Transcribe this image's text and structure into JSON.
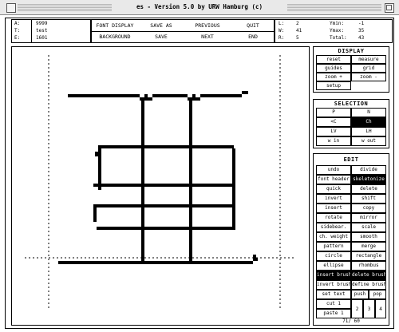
{
  "window": {
    "title": "es  -  Version 5.0  by URW Hamburg (c)"
  },
  "info": {
    "left": [
      {
        "key": "A:",
        "value": "9999"
      },
      {
        "key": "T:",
        "value": "test"
      },
      {
        "key": "E:",
        "value": "1601"
      }
    ],
    "mid": [
      {
        "key": "L:",
        "value": "2"
      },
      {
        "key": "W:",
        "value": "41"
      },
      {
        "key": "R:",
        "value": "5"
      }
    ],
    "right": [
      {
        "key": "Ymin:",
        "value": "-1"
      },
      {
        "key": "Ymax:",
        "value": "35"
      },
      {
        "key": "Total:",
        "value": "43"
      }
    ]
  },
  "toolbar": {
    "row1": [
      "FONT DISPLAY",
      "SAVE AS",
      "PREVIOUS",
      "QUIT"
    ],
    "row2": [
      "BACKGROUND",
      "SAVE",
      "NEXT",
      "END"
    ]
  },
  "display": {
    "title": "DISPLAY",
    "items": [
      "reset",
      "measure",
      "guides",
      "grid",
      "zoom +",
      "zoom -",
      "setup"
    ]
  },
  "selection": {
    "title": "SELECTION",
    "items": [
      "P",
      "N",
      "<C",
      "Ch",
      "LV",
      "LH",
      "w in",
      "w out"
    ],
    "active": "Ch"
  },
  "edit": {
    "title": "EDIT",
    "items": [
      "undo",
      "divide",
      "font header",
      "skeletonize",
      "quick",
      "delete",
      "invert",
      "shift",
      "insert",
      "copy",
      "rotate",
      "mirror",
      "sidebear.",
      "scale",
      "ch. weight",
      "smooth",
      "pattern",
      "merge",
      "circle",
      "rectangle",
      "ellipse",
      "rhombus",
      "insert brush",
      "delete brush",
      "invert brush",
      "define brush"
    ],
    "active": [
      "skeletonize",
      "insert brush",
      "delete brush"
    ],
    "set_text": "set text",
    "push": "push",
    "pop": "pop",
    "cut": "cut 1",
    "paste": "paste 1",
    "numbers": [
      "2",
      "3",
      "4"
    ],
    "footer": "71/    60"
  }
}
